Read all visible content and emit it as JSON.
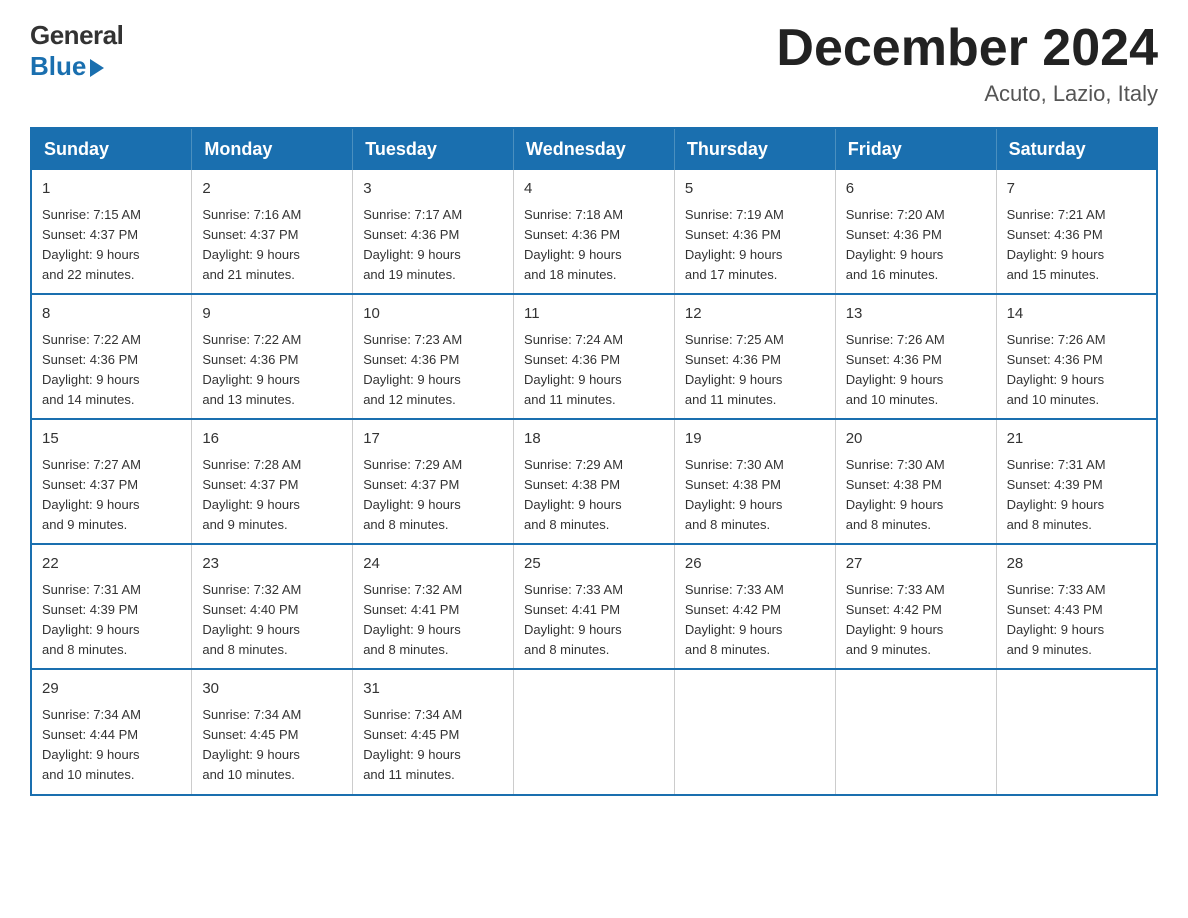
{
  "header": {
    "logo_general": "General",
    "logo_blue": "Blue",
    "main_title": "December 2024",
    "subtitle": "Acuto, Lazio, Italy"
  },
  "calendar": {
    "days_of_week": [
      "Sunday",
      "Monday",
      "Tuesday",
      "Wednesday",
      "Thursday",
      "Friday",
      "Saturday"
    ],
    "weeks": [
      [
        {
          "date": "1",
          "sunrise": "7:15 AM",
          "sunset": "4:37 PM",
          "daylight": "9 hours and 22 minutes."
        },
        {
          "date": "2",
          "sunrise": "7:16 AM",
          "sunset": "4:37 PM",
          "daylight": "9 hours and 21 minutes."
        },
        {
          "date": "3",
          "sunrise": "7:17 AM",
          "sunset": "4:36 PM",
          "daylight": "9 hours and 19 minutes."
        },
        {
          "date": "4",
          "sunrise": "7:18 AM",
          "sunset": "4:36 PM",
          "daylight": "9 hours and 18 minutes."
        },
        {
          "date": "5",
          "sunrise": "7:19 AM",
          "sunset": "4:36 PM",
          "daylight": "9 hours and 17 minutes."
        },
        {
          "date": "6",
          "sunrise": "7:20 AM",
          "sunset": "4:36 PM",
          "daylight": "9 hours and 16 minutes."
        },
        {
          "date": "7",
          "sunrise": "7:21 AM",
          "sunset": "4:36 PM",
          "daylight": "9 hours and 15 minutes."
        }
      ],
      [
        {
          "date": "8",
          "sunrise": "7:22 AM",
          "sunset": "4:36 PM",
          "daylight": "9 hours and 14 minutes."
        },
        {
          "date": "9",
          "sunrise": "7:22 AM",
          "sunset": "4:36 PM",
          "daylight": "9 hours and 13 minutes."
        },
        {
          "date": "10",
          "sunrise": "7:23 AM",
          "sunset": "4:36 PM",
          "daylight": "9 hours and 12 minutes."
        },
        {
          "date": "11",
          "sunrise": "7:24 AM",
          "sunset": "4:36 PM",
          "daylight": "9 hours and 11 minutes."
        },
        {
          "date": "12",
          "sunrise": "7:25 AM",
          "sunset": "4:36 PM",
          "daylight": "9 hours and 11 minutes."
        },
        {
          "date": "13",
          "sunrise": "7:26 AM",
          "sunset": "4:36 PM",
          "daylight": "9 hours and 10 minutes."
        },
        {
          "date": "14",
          "sunrise": "7:26 AM",
          "sunset": "4:36 PM",
          "daylight": "9 hours and 10 minutes."
        }
      ],
      [
        {
          "date": "15",
          "sunrise": "7:27 AM",
          "sunset": "4:37 PM",
          "daylight": "9 hours and 9 minutes."
        },
        {
          "date": "16",
          "sunrise": "7:28 AM",
          "sunset": "4:37 PM",
          "daylight": "9 hours and 9 minutes."
        },
        {
          "date": "17",
          "sunrise": "7:29 AM",
          "sunset": "4:37 PM",
          "daylight": "9 hours and 8 minutes."
        },
        {
          "date": "18",
          "sunrise": "7:29 AM",
          "sunset": "4:38 PM",
          "daylight": "9 hours and 8 minutes."
        },
        {
          "date": "19",
          "sunrise": "7:30 AM",
          "sunset": "4:38 PM",
          "daylight": "9 hours and 8 minutes."
        },
        {
          "date": "20",
          "sunrise": "7:30 AM",
          "sunset": "4:38 PM",
          "daylight": "9 hours and 8 minutes."
        },
        {
          "date": "21",
          "sunrise": "7:31 AM",
          "sunset": "4:39 PM",
          "daylight": "9 hours and 8 minutes."
        }
      ],
      [
        {
          "date": "22",
          "sunrise": "7:31 AM",
          "sunset": "4:39 PM",
          "daylight": "9 hours and 8 minutes."
        },
        {
          "date": "23",
          "sunrise": "7:32 AM",
          "sunset": "4:40 PM",
          "daylight": "9 hours and 8 minutes."
        },
        {
          "date": "24",
          "sunrise": "7:32 AM",
          "sunset": "4:41 PM",
          "daylight": "9 hours and 8 minutes."
        },
        {
          "date": "25",
          "sunrise": "7:33 AM",
          "sunset": "4:41 PM",
          "daylight": "9 hours and 8 minutes."
        },
        {
          "date": "26",
          "sunrise": "7:33 AM",
          "sunset": "4:42 PM",
          "daylight": "9 hours and 8 minutes."
        },
        {
          "date": "27",
          "sunrise": "7:33 AM",
          "sunset": "4:42 PM",
          "daylight": "9 hours and 9 minutes."
        },
        {
          "date": "28",
          "sunrise": "7:33 AM",
          "sunset": "4:43 PM",
          "daylight": "9 hours and 9 minutes."
        }
      ],
      [
        {
          "date": "29",
          "sunrise": "7:34 AM",
          "sunset": "4:44 PM",
          "daylight": "9 hours and 10 minutes."
        },
        {
          "date": "30",
          "sunrise": "7:34 AM",
          "sunset": "4:45 PM",
          "daylight": "9 hours and 10 minutes."
        },
        {
          "date": "31",
          "sunrise": "7:34 AM",
          "sunset": "4:45 PM",
          "daylight": "9 hours and 11 minutes."
        },
        null,
        null,
        null,
        null
      ]
    ]
  }
}
